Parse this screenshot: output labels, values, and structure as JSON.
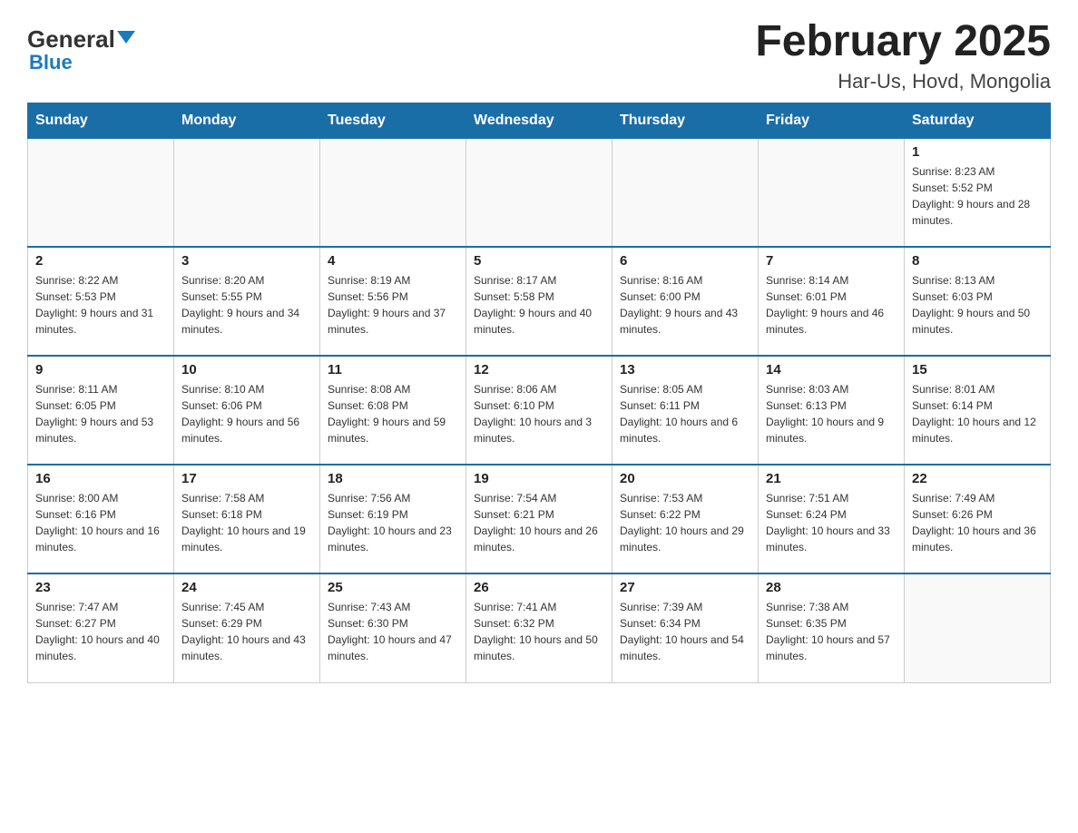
{
  "header": {
    "logo_general": "General",
    "logo_blue": "Blue",
    "title": "February 2025",
    "subtitle": "Har-Us, Hovd, Mongolia"
  },
  "days_of_week": [
    "Sunday",
    "Monday",
    "Tuesday",
    "Wednesday",
    "Thursday",
    "Friday",
    "Saturday"
  ],
  "weeks": [
    [
      {
        "day": "",
        "info": ""
      },
      {
        "day": "",
        "info": ""
      },
      {
        "day": "",
        "info": ""
      },
      {
        "day": "",
        "info": ""
      },
      {
        "day": "",
        "info": ""
      },
      {
        "day": "",
        "info": ""
      },
      {
        "day": "1",
        "info": "Sunrise: 8:23 AM\nSunset: 5:52 PM\nDaylight: 9 hours and 28 minutes."
      }
    ],
    [
      {
        "day": "2",
        "info": "Sunrise: 8:22 AM\nSunset: 5:53 PM\nDaylight: 9 hours and 31 minutes."
      },
      {
        "day": "3",
        "info": "Sunrise: 8:20 AM\nSunset: 5:55 PM\nDaylight: 9 hours and 34 minutes."
      },
      {
        "day": "4",
        "info": "Sunrise: 8:19 AM\nSunset: 5:56 PM\nDaylight: 9 hours and 37 minutes."
      },
      {
        "day": "5",
        "info": "Sunrise: 8:17 AM\nSunset: 5:58 PM\nDaylight: 9 hours and 40 minutes."
      },
      {
        "day": "6",
        "info": "Sunrise: 8:16 AM\nSunset: 6:00 PM\nDaylight: 9 hours and 43 minutes."
      },
      {
        "day": "7",
        "info": "Sunrise: 8:14 AM\nSunset: 6:01 PM\nDaylight: 9 hours and 46 minutes."
      },
      {
        "day": "8",
        "info": "Sunrise: 8:13 AM\nSunset: 6:03 PM\nDaylight: 9 hours and 50 minutes."
      }
    ],
    [
      {
        "day": "9",
        "info": "Sunrise: 8:11 AM\nSunset: 6:05 PM\nDaylight: 9 hours and 53 minutes."
      },
      {
        "day": "10",
        "info": "Sunrise: 8:10 AM\nSunset: 6:06 PM\nDaylight: 9 hours and 56 minutes."
      },
      {
        "day": "11",
        "info": "Sunrise: 8:08 AM\nSunset: 6:08 PM\nDaylight: 9 hours and 59 minutes."
      },
      {
        "day": "12",
        "info": "Sunrise: 8:06 AM\nSunset: 6:10 PM\nDaylight: 10 hours and 3 minutes."
      },
      {
        "day": "13",
        "info": "Sunrise: 8:05 AM\nSunset: 6:11 PM\nDaylight: 10 hours and 6 minutes."
      },
      {
        "day": "14",
        "info": "Sunrise: 8:03 AM\nSunset: 6:13 PM\nDaylight: 10 hours and 9 minutes."
      },
      {
        "day": "15",
        "info": "Sunrise: 8:01 AM\nSunset: 6:14 PM\nDaylight: 10 hours and 12 minutes."
      }
    ],
    [
      {
        "day": "16",
        "info": "Sunrise: 8:00 AM\nSunset: 6:16 PM\nDaylight: 10 hours and 16 minutes."
      },
      {
        "day": "17",
        "info": "Sunrise: 7:58 AM\nSunset: 6:18 PM\nDaylight: 10 hours and 19 minutes."
      },
      {
        "day": "18",
        "info": "Sunrise: 7:56 AM\nSunset: 6:19 PM\nDaylight: 10 hours and 23 minutes."
      },
      {
        "day": "19",
        "info": "Sunrise: 7:54 AM\nSunset: 6:21 PM\nDaylight: 10 hours and 26 minutes."
      },
      {
        "day": "20",
        "info": "Sunrise: 7:53 AM\nSunset: 6:22 PM\nDaylight: 10 hours and 29 minutes."
      },
      {
        "day": "21",
        "info": "Sunrise: 7:51 AM\nSunset: 6:24 PM\nDaylight: 10 hours and 33 minutes."
      },
      {
        "day": "22",
        "info": "Sunrise: 7:49 AM\nSunset: 6:26 PM\nDaylight: 10 hours and 36 minutes."
      }
    ],
    [
      {
        "day": "23",
        "info": "Sunrise: 7:47 AM\nSunset: 6:27 PM\nDaylight: 10 hours and 40 minutes."
      },
      {
        "day": "24",
        "info": "Sunrise: 7:45 AM\nSunset: 6:29 PM\nDaylight: 10 hours and 43 minutes."
      },
      {
        "day": "25",
        "info": "Sunrise: 7:43 AM\nSunset: 6:30 PM\nDaylight: 10 hours and 47 minutes."
      },
      {
        "day": "26",
        "info": "Sunrise: 7:41 AM\nSunset: 6:32 PM\nDaylight: 10 hours and 50 minutes."
      },
      {
        "day": "27",
        "info": "Sunrise: 7:39 AM\nSunset: 6:34 PM\nDaylight: 10 hours and 54 minutes."
      },
      {
        "day": "28",
        "info": "Sunrise: 7:38 AM\nSunset: 6:35 PM\nDaylight: 10 hours and 57 minutes."
      },
      {
        "day": "",
        "info": ""
      }
    ]
  ]
}
